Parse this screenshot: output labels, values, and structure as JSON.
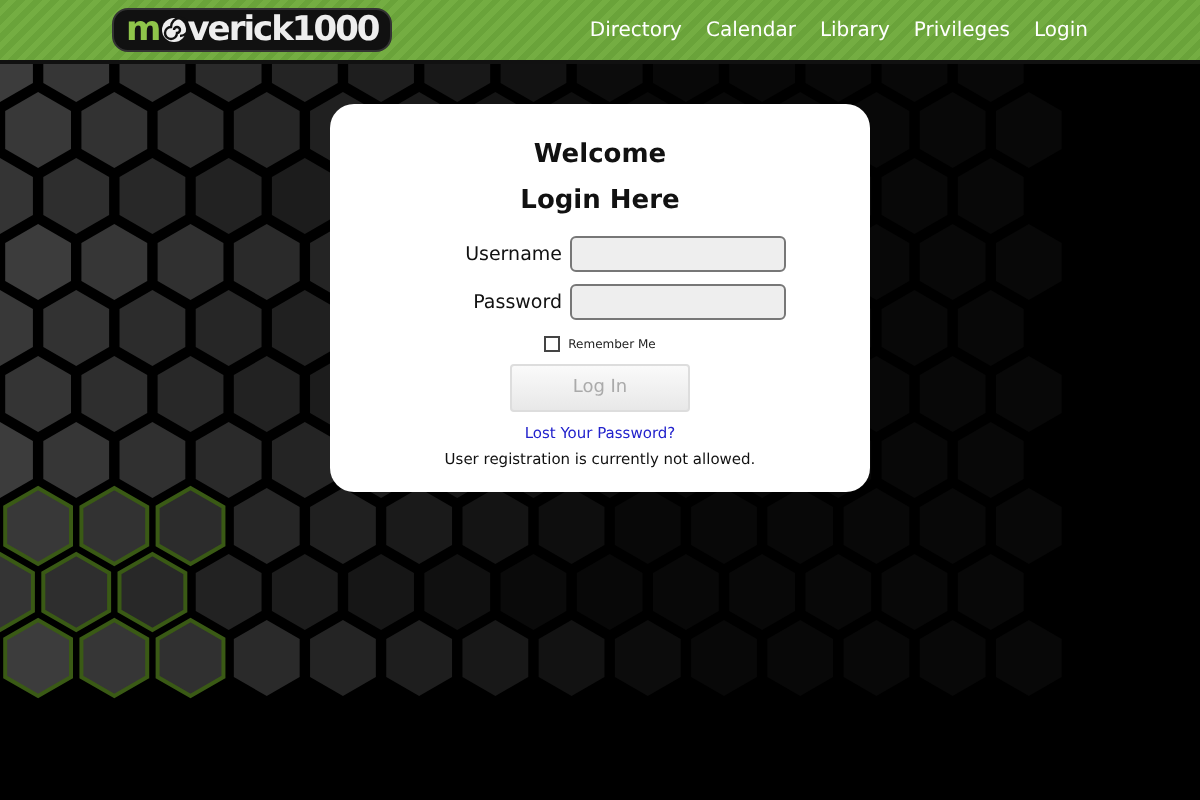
{
  "header": {
    "logo": {
      "before": "m",
      "after": "verick1000"
    },
    "nav": [
      "Directory",
      "Calendar",
      "Library",
      "Privileges",
      "Login"
    ]
  },
  "login": {
    "title": "Welcome",
    "subtitle": "Login Here",
    "fields": [
      {
        "label": "Username"
      },
      {
        "label": "Password"
      }
    ],
    "remember": {
      "label": "Remember Me",
      "checked": false
    },
    "button": {
      "label": "Log In",
      "disabled": true
    },
    "lost_password": "Lost Your Password?",
    "note": "User registration is currently not allowed."
  }
}
